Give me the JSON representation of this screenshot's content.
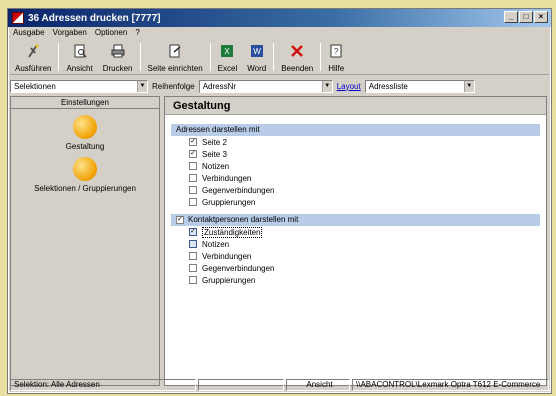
{
  "window": {
    "title": "36 Adressen drucken [7777]"
  },
  "menu": [
    "Ausgabe",
    "Vorgaben",
    "Optionen",
    "?"
  ],
  "toolbar": [
    {
      "label": "Ausführen",
      "icon": "execute-icon"
    },
    {
      "label": "Ansicht",
      "icon": "preview-icon"
    },
    {
      "label": "Drucken",
      "icon": "printer-icon"
    },
    {
      "label": "Seite einrichten",
      "icon": "page-setup-icon"
    },
    {
      "label": "Excel",
      "icon": "excel-icon"
    },
    {
      "label": "Word",
      "icon": "word-icon"
    },
    {
      "label": "Beenden",
      "icon": "close-icon"
    },
    {
      "label": "Hilfe",
      "icon": "help-icon"
    }
  ],
  "selection": {
    "selektionen": "Selektionen",
    "reihenfolge_label": "Reihenfolge",
    "reihenfolge_value": "AdressNr",
    "layout_link": "Layout",
    "layout_value": "Adressliste"
  },
  "left": {
    "header": "Einstellungen",
    "items": [
      {
        "label": "Gestaltung"
      },
      {
        "label": "Selektionen / Gruppierungen"
      }
    ]
  },
  "right": {
    "title": "Gestaltung",
    "group1": {
      "header": "Adressen darstellen mit",
      "items": [
        {
          "label": "Seite 2",
          "checked": true
        },
        {
          "label": "Seite 3",
          "checked": true
        },
        {
          "label": "Notizen",
          "checked": false
        },
        {
          "label": "Verbindungen",
          "checked": false
        },
        {
          "label": "Gegenverbindungen",
          "checked": false
        },
        {
          "label": "Gruppierungen",
          "checked": false
        }
      ]
    },
    "group2": {
      "header": "Kontaktpersonen darstellen mit",
      "checked": true,
      "items": [
        {
          "label": "Zuständigkeiten",
          "checked": true
        },
        {
          "label": "Notizen",
          "checked": false
        },
        {
          "label": "Verbindungen",
          "checked": false
        },
        {
          "label": "Gegenverbindungen",
          "checked": false
        },
        {
          "label": "Gruppierungen",
          "checked": false
        }
      ]
    }
  },
  "status": {
    "selektion": "Selektion: Alle Adressen",
    "mode": "Ansicht",
    "printer": "\\\\ABACONTROL\\Lexmark Optra T612 E-Commerce"
  },
  "colors": {
    "title_start": "#0a246a",
    "group_header": "#b8cce8",
    "link": "#0000cc"
  }
}
